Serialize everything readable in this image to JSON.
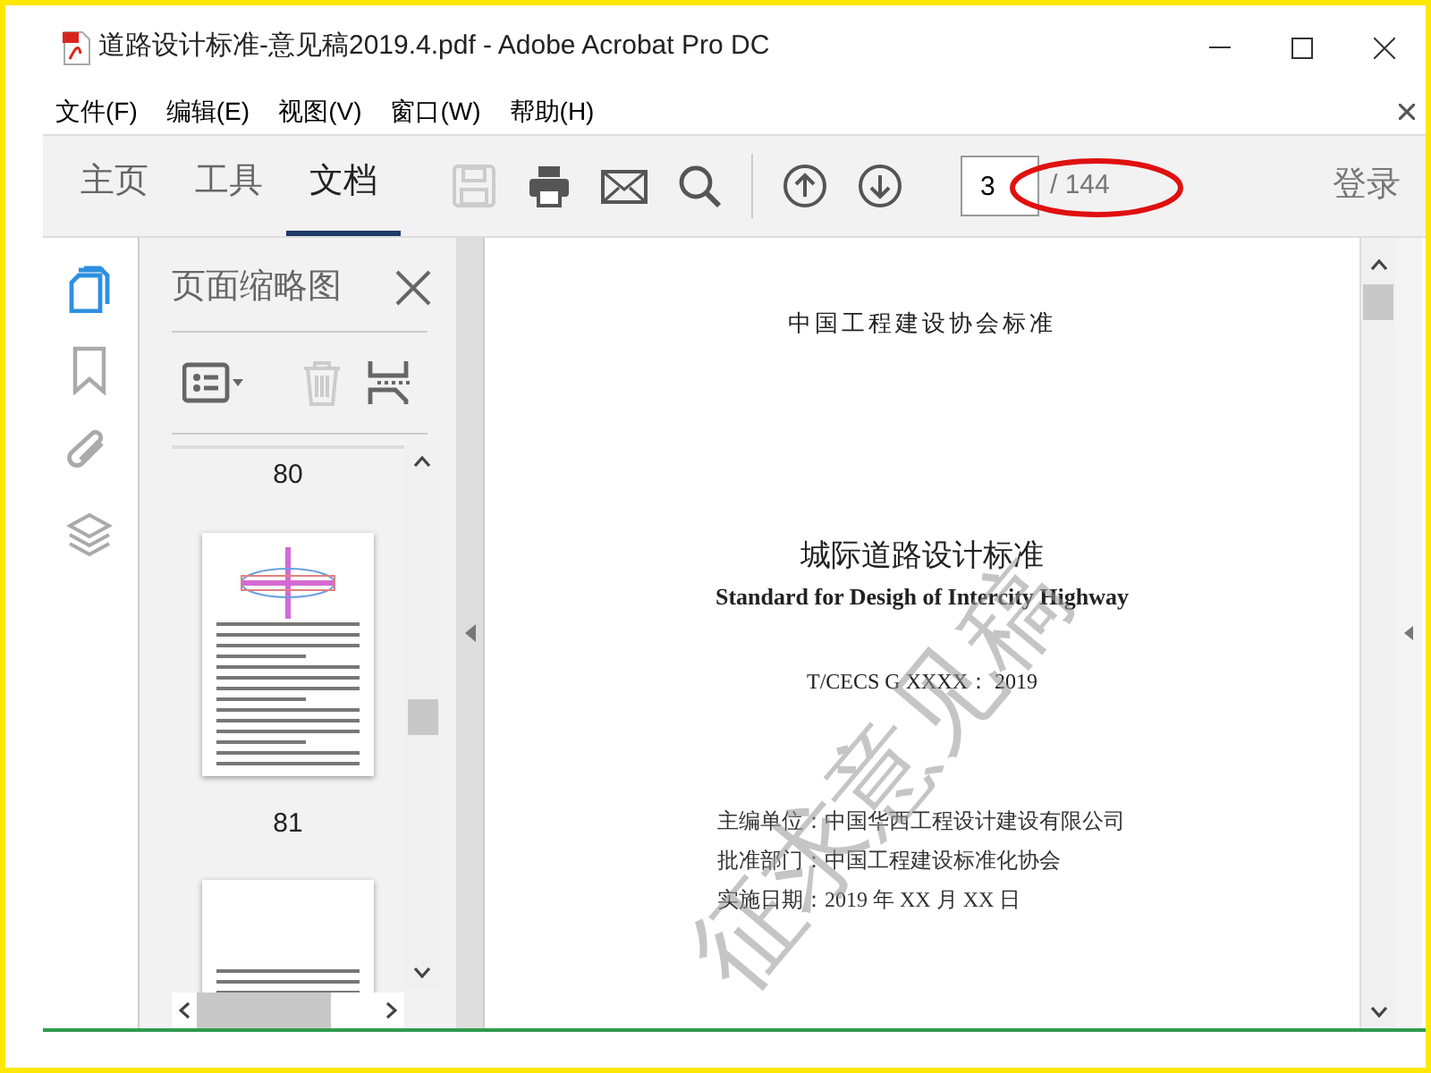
{
  "window": {
    "title": "道路设计标准-意见稿2019.4.pdf - Adobe Acrobat Pro DC"
  },
  "menu": [
    {
      "label": "文件(F)"
    },
    {
      "label": "编辑(E)"
    },
    {
      "label": "视图(V)"
    },
    {
      "label": "窗口(W)"
    },
    {
      "label": "帮助(H)"
    }
  ],
  "tabs": [
    {
      "label": "主页",
      "selected": false
    },
    {
      "label": "工具",
      "selected": false
    },
    {
      "label": "文档",
      "selected": true
    }
  ],
  "toolbar": [
    {
      "kind": "save",
      "disabled": true
    },
    {
      "kind": "print",
      "disabled": false
    },
    {
      "kind": "mail",
      "disabled": false
    },
    {
      "kind": "search",
      "disabled": false
    },
    {
      "kind": "sep"
    },
    {
      "kind": "up",
      "disabled": false
    },
    {
      "kind": "down",
      "disabled": false
    }
  ],
  "page_nav": {
    "current": "3",
    "total": "/ 144"
  },
  "sign_in": "登录",
  "side_rail": [
    {
      "kind": "pages",
      "selected": true
    },
    {
      "kind": "bookmark",
      "selected": false
    },
    {
      "kind": "attachment",
      "selected": false
    },
    {
      "kind": "layers",
      "selected": false
    }
  ],
  "panel": {
    "title": "页面缩略图",
    "tools": [
      {
        "kind": "options",
        "disabled": false
      },
      {
        "kind": "delete",
        "disabled": true
      },
      {
        "kind": "extract",
        "disabled": false
      }
    ],
    "thumbnails": [
      {
        "label": "80"
      },
      {
        "label": "81"
      }
    ]
  },
  "document": {
    "header": "中国工程建设协会标准",
    "title": "城际道路设计标准",
    "subtitle": "Standard for Desigh of Intercity Highway",
    "code": "T/CECS G XXXX：  2019",
    "info": [
      "主编单位：中国华西工程设计建设有限公司",
      "批准部门：中国工程建设标准化协会",
      "实施日期：2019 年 XX 月 XX 日"
    ],
    "watermark": "征求意见稿"
  }
}
